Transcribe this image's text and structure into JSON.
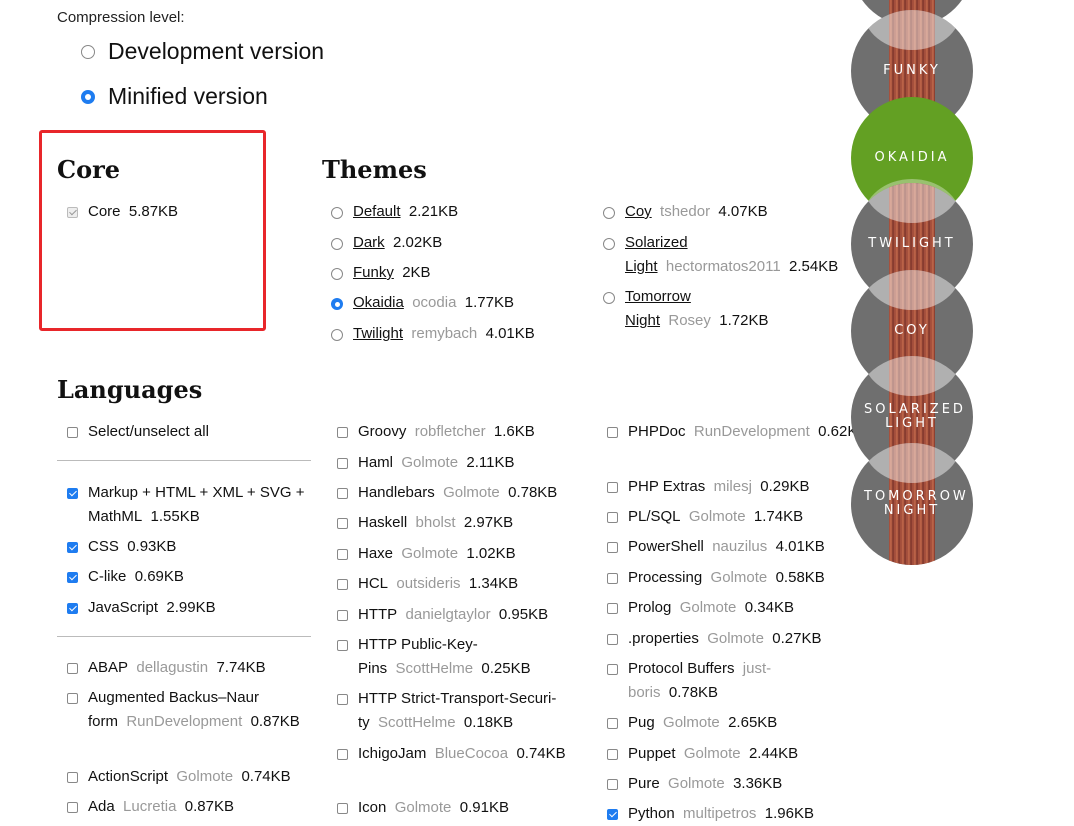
{
  "compression": {
    "label": "Compression level:",
    "options": [
      {
        "label": "Development version",
        "checked": false
      },
      {
        "label": "Minified version",
        "checked": true
      }
    ]
  },
  "core": {
    "title": "Core",
    "item": {
      "name": "Core",
      "size": "5.87KB",
      "checked": true
    }
  },
  "themes": {
    "title": "Themes",
    "col1": [
      {
        "name": "Default",
        "owner": "",
        "size": "2.21KB",
        "checked": false
      },
      {
        "name": "Dark",
        "owner": "",
        "size": "2.02KB",
        "checked": false
      },
      {
        "name": "Funky",
        "owner": "",
        "size": "2KB",
        "checked": false
      },
      {
        "name": "Okaidia",
        "owner": "ocodia",
        "size": "1.77KB",
        "checked": true
      },
      {
        "name": "Twilight",
        "owner": "remybach",
        "size": "4.01KB",
        "checked": false
      }
    ],
    "col2": [
      {
        "name": "Coy",
        "owner": "tshedor",
        "size": "4.07KB",
        "checked": false
      },
      {
        "name": "Solarized Light",
        "owner": "hectormatos2011",
        "size": "2.54KB",
        "checked": false
      },
      {
        "name": "Tomorrow Night",
        "owner": "Rosey",
        "size": "1.72KB",
        "checked": false
      }
    ]
  },
  "languages": {
    "title": "Languages",
    "select_all": "Select/unselect all",
    "col1_top": [
      {
        "name": "Markup + HTML + XML + SVG + MathML",
        "owner": "",
        "size": "1.55KB",
        "checked": true
      },
      {
        "name": "CSS",
        "owner": "",
        "size": "0.93KB",
        "checked": true
      },
      {
        "name": "C-like",
        "owner": "",
        "size": "0.69KB",
        "checked": true
      },
      {
        "name": "JavaScript",
        "owner": "",
        "size": "2.99KB",
        "checked": true
      }
    ],
    "col1_bottom": [
      {
        "name": "ABAP",
        "owner": "dellagustin",
        "size": "7.74KB",
        "checked": false
      },
      {
        "name": "Augmented Backus–Naur form",
        "owner": "RunDevelopment",
        "size": "0.87KB",
        "checked": false
      },
      {
        "name": "ActionScript",
        "owner": "Golmote",
        "size": "0.74KB",
        "checked": false
      },
      {
        "name": "Ada",
        "owner": "Lucretia",
        "size": "0.87KB",
        "checked": false
      }
    ],
    "col2": [
      {
        "name": "Groovy",
        "owner": "robfletcher",
        "size": "1.6KB",
        "checked": false
      },
      {
        "name": "Haml",
        "owner": "Golmote",
        "size": "2.11KB",
        "checked": false
      },
      {
        "name": "Handlebars",
        "owner": "Golmote",
        "size": "0.78KB",
        "checked": false
      },
      {
        "name": "Haskell",
        "owner": "bholst",
        "size": "2.97KB",
        "checked": false
      },
      {
        "name": "Haxe",
        "owner": "Golmote",
        "size": "1.02KB",
        "checked": false
      },
      {
        "name": "HCL",
        "owner": "outsideris",
        "size": "1.34KB",
        "checked": false
      },
      {
        "name": "HTTP",
        "owner": "danielgtaylor",
        "size": "0.95KB",
        "checked": false
      },
      {
        "name": "HTTP Public-Key-Pins",
        "owner": "ScottHelme",
        "size": "0.25KB",
        "checked": false
      },
      {
        "name": "HTTP Strict-Transport-Securi-ty",
        "owner": "ScottHelme",
        "size": "0.18KB",
        "checked": false
      },
      {
        "name": "IchigoJam",
        "owner": "BlueCocoa",
        "size": "0.74KB",
        "checked": false
      },
      {
        "name": "Icon",
        "owner": "Golmote",
        "size": "0.91KB",
        "checked": false
      }
    ],
    "col3": [
      {
        "name": "PHPDoc",
        "owner": "RunDevelopment",
        "size": "0.62KB",
        "checked": false
      },
      {
        "name": "PHP Extras",
        "owner": "milesj",
        "size": "0.29KB",
        "checked": false
      },
      {
        "name": "PL/SQL",
        "owner": "Golmote",
        "size": "1.74KB",
        "checked": false
      },
      {
        "name": "PowerShell",
        "owner": "nauzilus",
        "size": "4.01KB",
        "checked": false
      },
      {
        "name": "Processing",
        "owner": "Golmote",
        "size": "0.58KB",
        "checked": false
      },
      {
        "name": "Prolog",
        "owner": "Golmote",
        "size": "0.34KB",
        "checked": false
      },
      {
        "name": ".properties",
        "owner": "Golmote",
        "size": "0.27KB",
        "checked": false
      },
      {
        "name": "Protocol Buffers",
        "owner": "just-boris",
        "size": "0.78KB",
        "checked": false
      },
      {
        "name": "Pug",
        "owner": "Golmote",
        "size": "2.65KB",
        "checked": false
      },
      {
        "name": "Puppet",
        "owner": "Golmote",
        "size": "2.44KB",
        "checked": false
      },
      {
        "name": "Pure",
        "owner": "Golmote",
        "size": "3.36KB",
        "checked": false
      },
      {
        "name": "Python",
        "owner": "multipetros",
        "size": "1.96KB",
        "checked": true
      }
    ]
  },
  "theme_discs": [
    {
      "label": "FUNKY",
      "active": false
    },
    {
      "label": "OKAIDIA",
      "active": true
    },
    {
      "label": "TWILIGHT",
      "active": false
    },
    {
      "label": "COY",
      "active": false
    },
    {
      "label": "SOLARIZED LIGHT",
      "active": false
    },
    {
      "label": "TOMORROW NIGHT",
      "active": false
    }
  ],
  "colors": {
    "accent": "#1e7cf0",
    "highlight_box": "#e8262a",
    "okaidia_green": "#63a023"
  }
}
